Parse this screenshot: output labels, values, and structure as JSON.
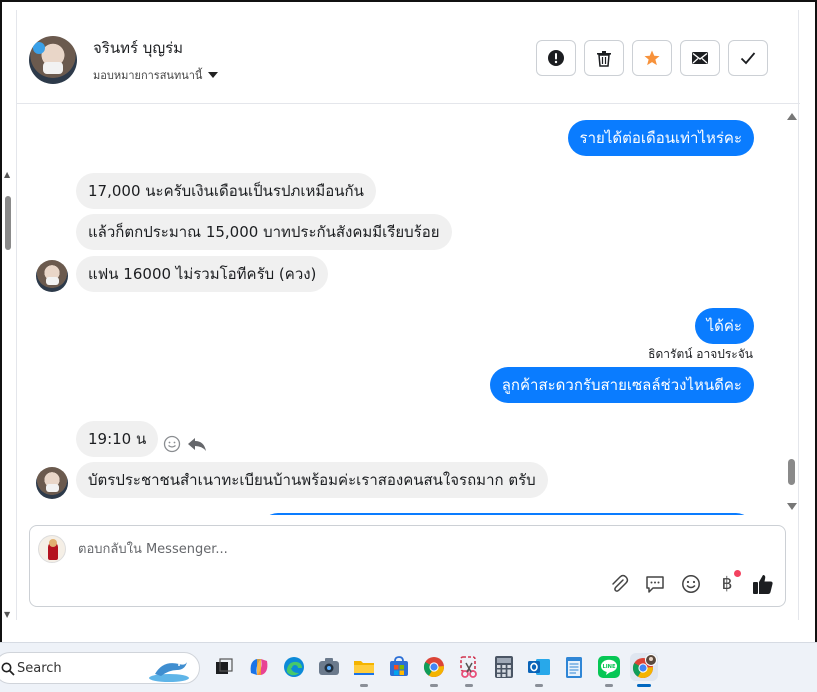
{
  "header": {
    "contact_name": "จรินทร์ บุญร่ม",
    "assign_label": "มอบหมายการสนทนานี้",
    "actions": [
      {
        "name": "report-spam-button",
        "icon": "exclamation-icon"
      },
      {
        "name": "delete-button",
        "icon": "trash-icon"
      },
      {
        "name": "star-button",
        "icon": "star-icon"
      },
      {
        "name": "mark-unread-button",
        "icon": "envelope-icon"
      },
      {
        "name": "mark-done-button",
        "icon": "check-icon"
      }
    ]
  },
  "messages": [
    {
      "direction": "out",
      "text": "รายได้ต่อเดือนเท่าไหร่คะ"
    },
    {
      "direction": "in",
      "text": "17,000 นะครับเงินเดือนเป็นรปภเหมือนกัน"
    },
    {
      "direction": "in",
      "text": "แล้วก็ตกประมาณ 15,000 บาทประกันสังคมมีเรียบร้อย"
    },
    {
      "direction": "in",
      "text": "แฟน 16000 ไม่รวมโอทีครับ (ควง)"
    },
    {
      "direction": "out",
      "text": "ได้ค่ะ"
    },
    {
      "direction": "out",
      "sender": "ธิดารัตน์ อาจประจัน",
      "text": "ลูกค้าสะดวกรับสายเซลล์ช่วงไหนดีคะ"
    },
    {
      "direction": "in",
      "text": "19:10 น"
    },
    {
      "direction": "in",
      "text": "บัตรประชาชนสำเนาทะเบียนบ้านพร้อมค่ะเราสองคนสนใจรถมาก ตรับ"
    }
  ],
  "composer": {
    "placeholder": "ตอบกลับใน Messenger...",
    "value": "",
    "tools": [
      "paperclip-icon",
      "saved-reply-icon",
      "emoji-icon",
      "baht-icon",
      "thumbs-up-icon"
    ],
    "baht_symbol": "฿"
  },
  "taskbar": {
    "search_label": "Search",
    "apps": [
      "task-view",
      "copilot",
      "edge",
      "camera",
      "file-explorer",
      "microsoft-store",
      "chrome",
      "snipping-tool",
      "calculator",
      "outlook",
      "notepad",
      "line",
      "chrome-profile"
    ]
  },
  "colors": {
    "outgoing_bubble": "#0a7cff",
    "incoming_bubble": "#f0f0f0",
    "star": "#f7923b"
  }
}
